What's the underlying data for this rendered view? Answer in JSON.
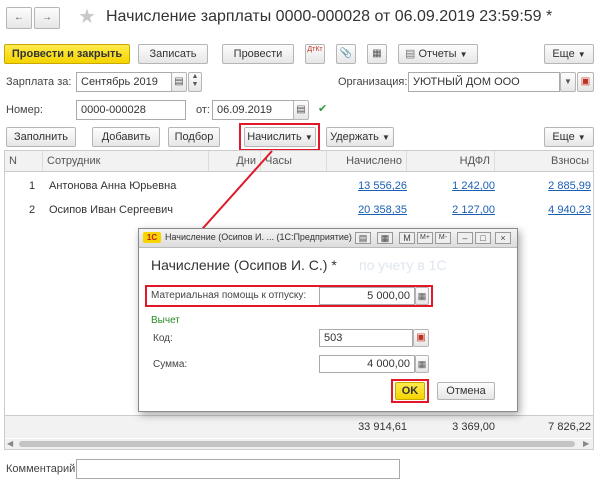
{
  "title": "Начисление зарплаты 0000-000028 от 06.09.2019 23:59:59 *",
  "toolbar": {
    "post_close": "Провести и закрыть",
    "save": "Записать",
    "post": "Провести",
    "dt_kt": "ДтКт",
    "reports": "Отчеты",
    "more": "Еще"
  },
  "header": {
    "salary_for_label": "Зарплата за:",
    "salary_for_value": "Сентябрь 2019",
    "organization_label": "Организация:",
    "organization_value": "УЮТНЫЙ ДОМ ООО",
    "number_label": "Номер:",
    "number_value": "0000-000028",
    "date_label": "от:",
    "date_value": "06.09.2019"
  },
  "table_toolbar": {
    "fill": "Заполнить",
    "add": "Добавить",
    "pick": "Подбор",
    "accrue": "Начислить",
    "withhold": "Удержать",
    "more": "Еще"
  },
  "table": {
    "columns": [
      "N",
      "Сотрудник",
      "Дни",
      "Часы",
      "Начислено",
      "НДФЛ",
      "Взносы"
    ],
    "rows": [
      {
        "n": "1",
        "employee": "Антонова Анна Юрьевна",
        "accrued": "13 556,26",
        "ndfl": "1 242,00",
        "contrib": "2 885,99"
      },
      {
        "n": "2",
        "employee": "Осипов Иван Сергеевич",
        "accrued": "20 358,35",
        "ndfl": "2 127,00",
        "contrib": "4 940,23"
      }
    ],
    "totals": {
      "accrued": "33 914,61",
      "ndfl": "3 369,00",
      "contrib": "7 826,22"
    }
  },
  "comment_label": "Комментарий:",
  "dialog": {
    "window_title": "Начисление (Осипов И. ...  (1С:Предприятие)",
    "heading": "Начисление (Осипов И. С.) *",
    "field_label": "Материальная помощь к отпуску:",
    "field_value": "5 000,00",
    "section": "Вычет",
    "code_label": "Код:",
    "code_value": "503",
    "sum_label": "Сумма:",
    "sum_value": "4 000,00",
    "ok": "OK",
    "cancel": "Отмена"
  },
  "watermark": "по учету в 1С",
  "colors": {
    "accent_yellow": "#f5d400",
    "highlight_red": "#e0182a",
    "link_blue": "#1a5fb4"
  }
}
